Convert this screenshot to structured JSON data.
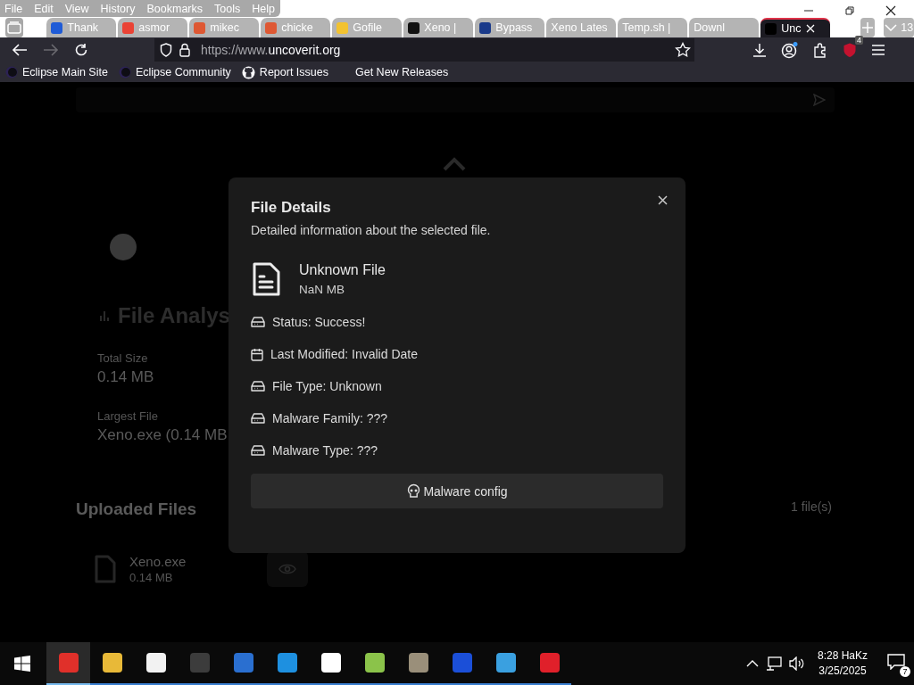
{
  "menu": [
    "File",
    "Edit",
    "View",
    "History",
    "Bookmarks",
    "Tools",
    "Help"
  ],
  "tabs": [
    {
      "label": "Thank",
      "color": "#1f5bd6",
      "selected": false
    },
    {
      "label": "asmor",
      "color": "#ea4335",
      "selected": false
    },
    {
      "label": "mikec",
      "color": "#de5833",
      "selected": false
    },
    {
      "label": "chicke",
      "color": "#de5833",
      "selected": false
    },
    {
      "label": "Gofile",
      "color": "#f2c230",
      "selected": false
    },
    {
      "label": "Xeno |",
      "color": "#111111",
      "selected": false
    },
    {
      "label": "Bypass",
      "color": "#1a3a8a",
      "selected": false
    },
    {
      "label": "Xeno Lates",
      "selected": false
    },
    {
      "label": "Temp.sh | ",
      "selected": false
    },
    {
      "label": "Downl",
      "selected": false
    },
    {
      "label": "Unc",
      "color": "#000000",
      "selected": true
    }
  ],
  "tab_count": "13",
  "url": {
    "host": "https://www.",
    "domain": "uncoverit.org"
  },
  "extension_badge": "4",
  "bookmarks": [
    {
      "label": "Eclipse Main Site",
      "kind": "eclipse"
    },
    {
      "label": "Eclipse Community",
      "kind": "eclipse"
    },
    {
      "label": "Report Issues",
      "kind": "github"
    },
    {
      "label": "Get New Releases",
      "kind": "none"
    }
  ],
  "page": {
    "analysis_title": "File Analys",
    "stats": [
      {
        "label": "Total Size",
        "value": "0.14 MB"
      },
      {
        "label": "Largest File",
        "value": "Xeno.exe (0.14 MB"
      }
    ],
    "uploaded_title": "Uploaded Files",
    "file_count": "1 file(s)",
    "files": [
      {
        "name": "Xeno.exe",
        "size": "0.14 MB"
      }
    ]
  },
  "modal": {
    "title": "File Details",
    "subtitle": "Detailed information about the selected file.",
    "file_name": "Unknown File",
    "file_size": "NaN MB",
    "details": [
      {
        "kind": "drive",
        "text": "Status: Success!"
      },
      {
        "kind": "calendar",
        "text": "Last Modified: Invalid Date"
      },
      {
        "kind": "drive",
        "text": "File Type: Unknown"
      },
      {
        "kind": "drive",
        "text": "Malware Family: ???"
      },
      {
        "kind": "drive",
        "text": "Malware Type: ???"
      }
    ],
    "button": "Malware config"
  },
  "taskbar": {
    "apps": [
      {
        "color": "#e0302a",
        "selected": true
      },
      {
        "color": "#e8b938",
        "selected": false
      },
      {
        "color": "#f2f2f2",
        "selected": false
      },
      {
        "color": "#3c3c3c",
        "selected": false
      },
      {
        "color": "#2a6fd0",
        "selected": false
      },
      {
        "color": "#1e90e0",
        "selected": false
      },
      {
        "color": "#ffffff",
        "selected": false
      },
      {
        "color": "#8bc34a",
        "selected": false
      },
      {
        "color": "#9a8f7a",
        "selected": false
      },
      {
        "color": "#1b4fd8",
        "selected": false
      },
      {
        "color": "#3aa0e0",
        "selected": false
      },
      {
        "color": "#e0202a",
        "selected": false
      }
    ],
    "time": "8:28 HaKz",
    "date": "3/25/2025",
    "notifications": "7"
  }
}
